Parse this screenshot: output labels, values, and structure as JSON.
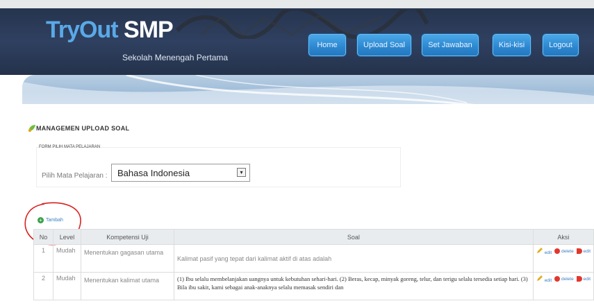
{
  "header": {
    "brand_main": "TryOut",
    "brand_accent": "SMP",
    "tagline": "Sekolah Menengah Pertama",
    "nav": [
      {
        "label": "Home"
      },
      {
        "label": "Upload Soal"
      },
      {
        "label": "Set Jawaban"
      },
      {
        "label": "Kisi-kisi"
      },
      {
        "label": "Logout"
      }
    ]
  },
  "section": {
    "title": "MANAGEMEN UPLOAD SOAL",
    "form_caption": "FORM PILIH MATA PELAJARAN",
    "select_label": "Pilih Mata Pelajaran :",
    "select_value": "Bahasa Indonesia",
    "add_label": "Tambah"
  },
  "table": {
    "headers": [
      "No",
      "Level",
      "Kompetensi Uji",
      "Soal",
      "Aksi"
    ],
    "rows": [
      {
        "no": "1",
        "level": "Mudah",
        "kompetensi": "Menentukan gagasan utama",
        "soal": "Kalimat pasif yang tepat dari kalimat aktif di atas adalah",
        "actions": [
          "edit",
          "delete",
          "edit"
        ]
      },
      {
        "no": "2",
        "level": "Mudah",
        "kompetensi": "Menentukan kalimat utama",
        "soal": "(1) Ibu selalu membelanjakan uangnya untuk kebutuhan sehari-hari. (2) Beras, kecap, minyak goreng, telur, dan terigu selalu tersedia setiap hari. (3) Bila ibu sakit, kami sebagai anak-anaknya selalu memasak sendiri dan",
        "actions": [
          "edit",
          "delete",
          "edit"
        ]
      }
    ]
  },
  "colors": {
    "header_bg": "#2f4060",
    "brand_blue": "#5aa9e8",
    "nav_button": "#2c87d0",
    "annotation_red": "#d8201f"
  }
}
